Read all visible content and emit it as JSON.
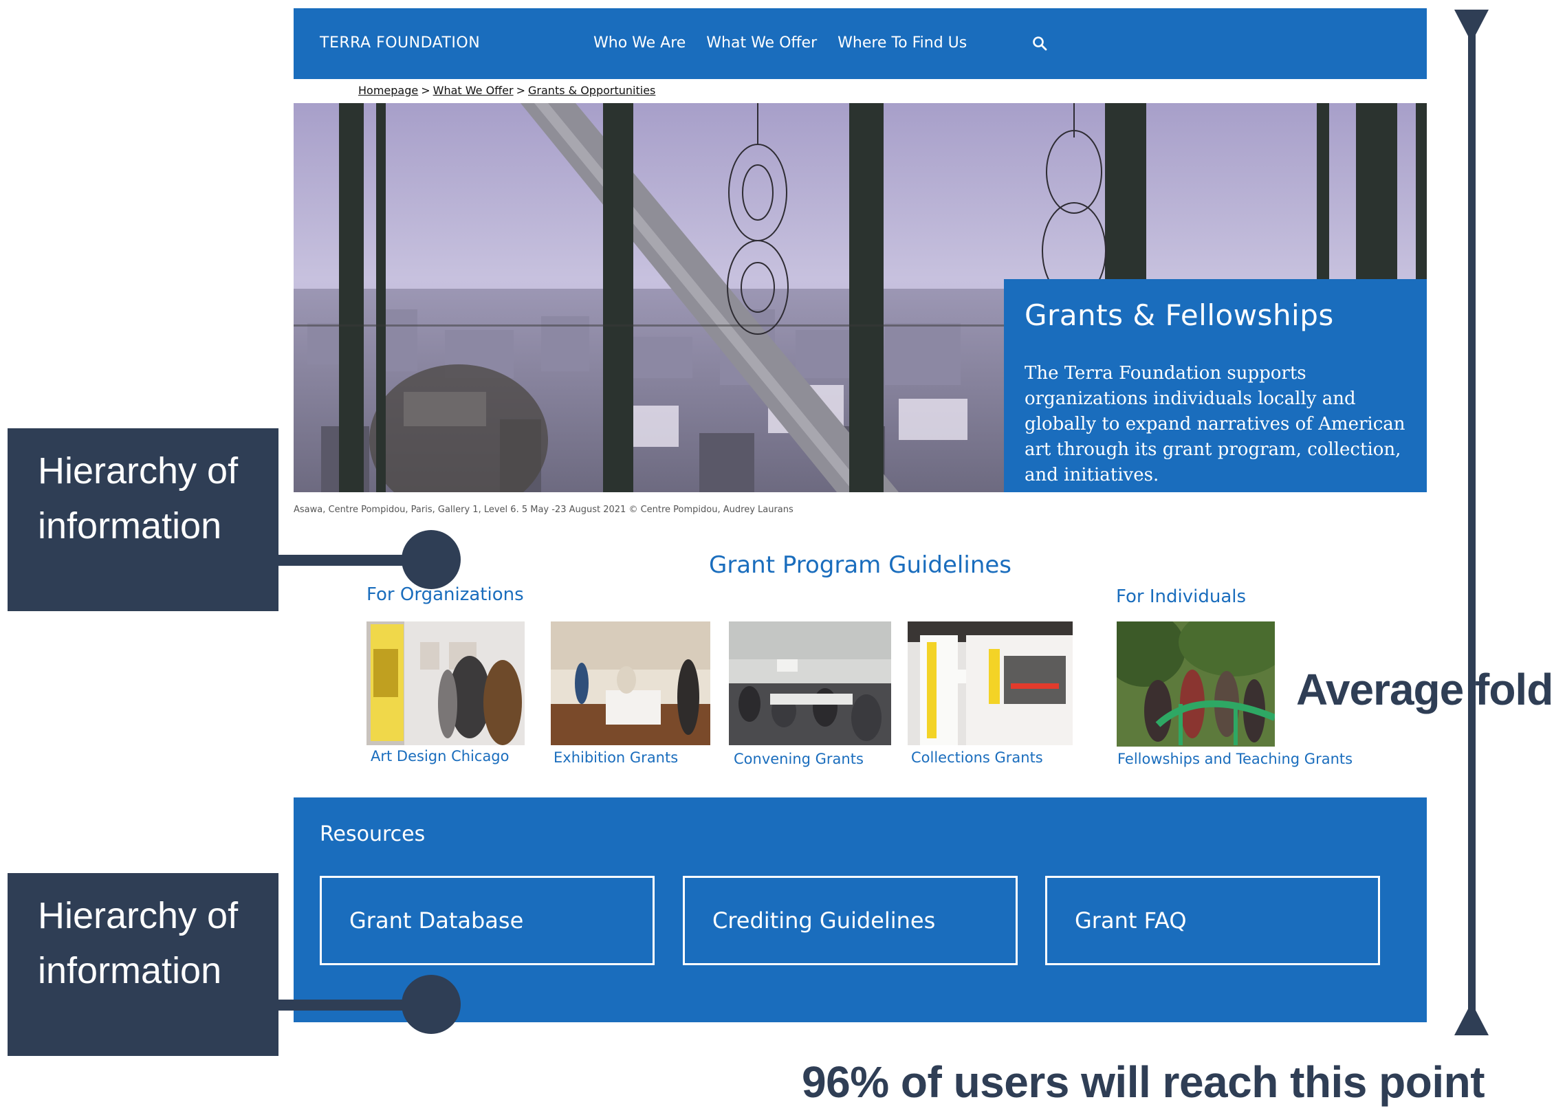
{
  "colors": {
    "brand": "#1a6dbd",
    "annotation": "#2f3e55"
  },
  "nav": {
    "logo": "TERRA FOUNDATION",
    "links": [
      "Who We Are",
      "What We Offer",
      "Where To Find Us"
    ],
    "search_icon": "search-icon"
  },
  "breadcrumb": [
    "Homepage",
    "What We Offer",
    "Grants & Opportunities"
  ],
  "breadcrumb_separator": ">",
  "hero": {
    "title": "Grants & Fellowships",
    "text": "The Terra Foundation supports organizations individuals locally and globally to expand narratives of American art through its grant program, collection, and initiatives.",
    "caption": "Asawa, Centre Pompidou, Paris, Gallery 1, Level 6. 5 May -23 August 2021 © Centre Pompidou, Audrey Laurans"
  },
  "guidelines": {
    "title": "Grant Program Guidelines",
    "organizations_label": "For Organizations",
    "individuals_label": "For Individuals",
    "cards": [
      "Art Design Chicago",
      "Exhibition Grants",
      "Convening Grants",
      "Collections Grants",
      "Fellowships and Teaching Grants"
    ]
  },
  "resources": {
    "title": "Resources",
    "buttons": [
      "Grant Database",
      "Crediting Guidelines",
      "Grant FAQ"
    ]
  },
  "annotations": {
    "hierarchy_1": "Hierarchy of information",
    "hierarchy_2": "Hierarchy of information",
    "fold": "Average fold",
    "reach": "96% of users will reach this point"
  }
}
